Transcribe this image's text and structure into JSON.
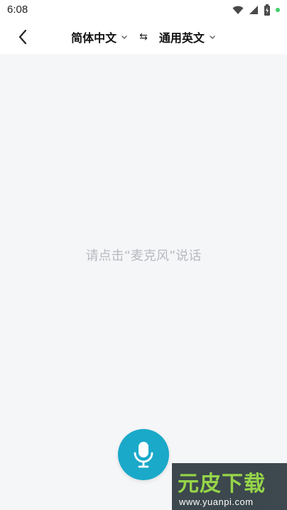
{
  "status_bar": {
    "time": "6:08",
    "icons": [
      "wifi-icon",
      "cell-signal-icon",
      "battery-icon",
      "notification-dot-icon"
    ],
    "dot_color": "#3ccf6b"
  },
  "header": {
    "source_lang": "简体中文",
    "target_lang": "通用英文",
    "swap_symbol": "⇆",
    "back_icon": "back-arrow-icon"
  },
  "content": {
    "hint": "请点击“麦克风”说话"
  },
  "mic_button": {
    "icon": "microphone-icon",
    "color": "#1aa9c9"
  },
  "watermark": {
    "title": "元皮下载",
    "url": "www.yuanpi.com"
  }
}
